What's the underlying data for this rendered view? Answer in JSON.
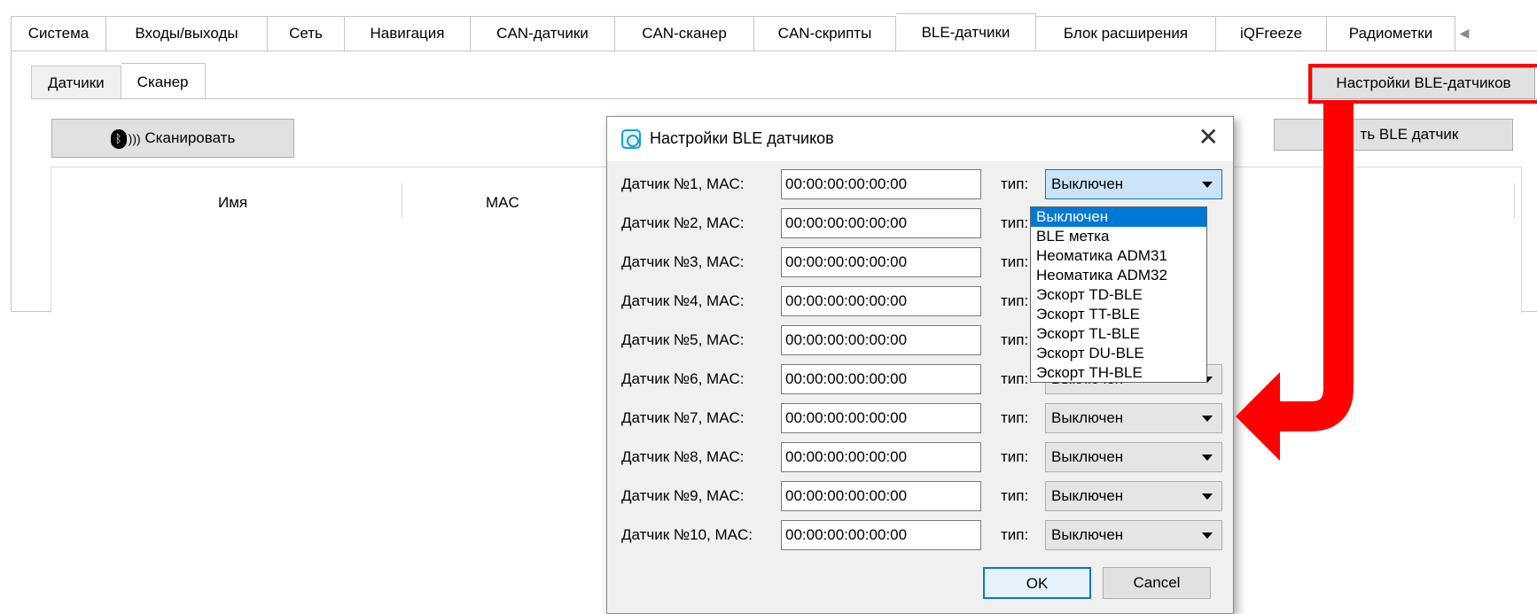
{
  "main_tabs": [
    "Система",
    "Входы/выходы",
    "Сеть",
    "Навигация",
    "CAN-датчики",
    "CAN-сканер",
    "CAN-скрипты",
    "BLE-датчики",
    "Блок расширения",
    "iQFreeze",
    "Радиометки"
  ],
  "main_tab_active": "BLE-датчики",
  "sub_tabs": [
    "Датчики",
    "Сканер"
  ],
  "sub_tab_active": "Сканер",
  "scan_button": "Сканировать",
  "save_button": "Со   ть BLE датчик",
  "settings_button": "Настройки BLE-датчиков",
  "grid_headers": {
    "name": "Имя",
    "mac": "MAC"
  },
  "dialog": {
    "title": "Настройки BLE датчиков",
    "type_label": "тип:",
    "rows": [
      {
        "label": "Датчик №1, MAC:",
        "mac": "00:00:00:00:00:00",
        "type": "Выключен"
      },
      {
        "label": "Датчик №2, MAC:",
        "mac": "00:00:00:00:00:00",
        "type": ""
      },
      {
        "label": "Датчик №3, MAC:",
        "mac": "00:00:00:00:00:00",
        "type": ""
      },
      {
        "label": "Датчик №4, MAC:",
        "mac": "00:00:00:00:00:00",
        "type": ""
      },
      {
        "label": "Датчик №5, MAC:",
        "mac": "00:00:00:00:00:00",
        "type": ""
      },
      {
        "label": "Датчик №6, MAC:",
        "mac": "00:00:00:00:00:00",
        "type": "Выключен"
      },
      {
        "label": "Датчик №7, MAC:",
        "mac": "00:00:00:00:00:00",
        "type": "Выключен"
      },
      {
        "label": "Датчик №8, MAC:",
        "mac": "00:00:00:00:00:00",
        "type": "Выключен"
      },
      {
        "label": "Датчик №9, MAC:",
        "mac": "00:00:00:00:00:00",
        "type": "Выключен"
      },
      {
        "label": "Датчик №10, MAC:",
        "mac": "00:00:00:00:00:00",
        "type": "Выключен"
      }
    ],
    "dropdown_options": [
      "Выключен",
      "BLE метка",
      "Неоматика ADM31",
      "Неоматика ADM32",
      "Эскорт TD-BLE",
      "Эскорт TT-BLE",
      "Эскорт TL-BLE",
      "Эскорт DU-BLE",
      "Эскорт TH-BLE"
    ],
    "dropdown_selected": "Выключен",
    "ok": "OK",
    "cancel": "Cancel"
  },
  "colors": {
    "highlight": "#ff0000",
    "accent": "#0078d7"
  }
}
